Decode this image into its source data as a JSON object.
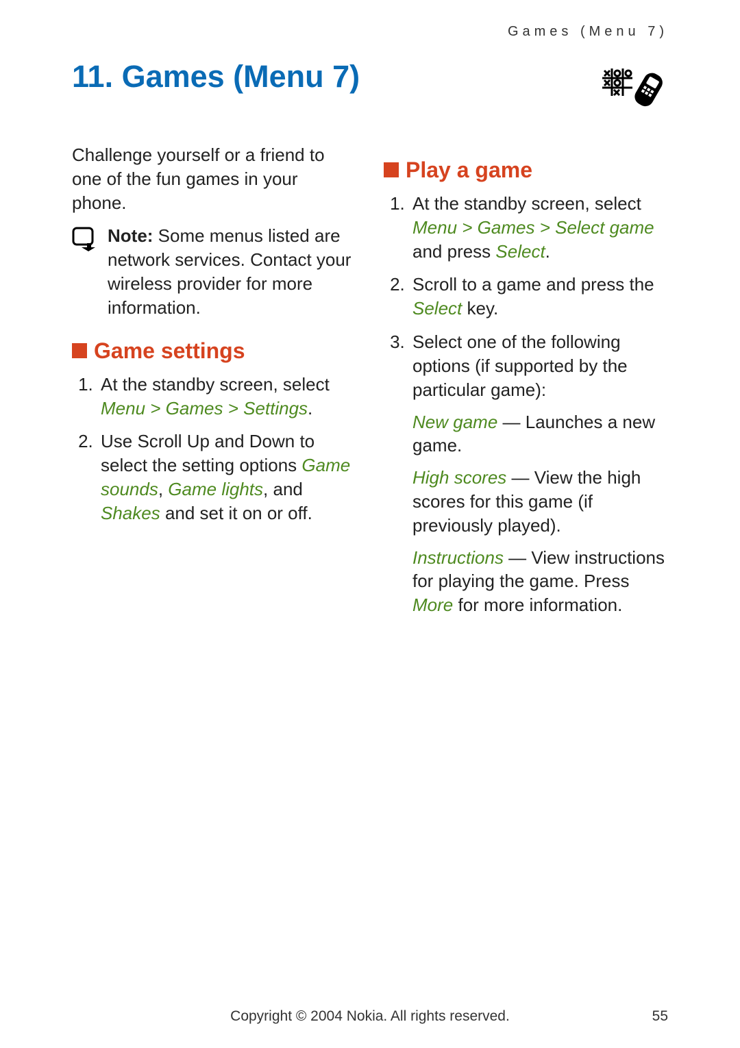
{
  "running_head": "Games (Menu 7)",
  "chapter_title": "11. Games (Menu 7)",
  "intro": "Challenge yourself or a friend to one of the fun games in your phone.",
  "note": {
    "label": "Note:",
    "body": " Some menus listed are network services. Contact your wireless provider for more information."
  },
  "section_settings": {
    "heading": "Game settings",
    "steps": {
      "s1_a": "At the standby screen, select ",
      "s1_b": "Menu > Games > Settings",
      "s1_c": ".",
      "s2_a": "Use Scroll Up and Down to select the setting options ",
      "s2_b": "Game sounds",
      "s2_c": ", ",
      "s2_d": "Game lights",
      "s2_e": ", and ",
      "s2_f": "Shakes",
      "s2_g": " and set it on or off."
    }
  },
  "section_play": {
    "heading": "Play a game",
    "steps": {
      "s1_a": "At the standby screen, select ",
      "s1_b": "Menu > Games > Select game",
      "s1_c": " and press ",
      "s1_d": "Select",
      "s1_e": ".",
      "s2_a": "Scroll to a game and press the ",
      "s2_b": "Select",
      "s2_c": " key.",
      "s3": "Select one of the following options (if supported by the particular game):"
    },
    "opts": {
      "o1_a": "New game",
      "o1_b": " — Launches a new game.",
      "o2_a": "High scores",
      "o2_b": " — View the high scores for this game (if previously played).",
      "o3_a": "Instructions",
      "o3_b": " — View instructions for playing the game. Press ",
      "o3_c": "More",
      "o3_d": " for more information."
    }
  },
  "footer": {
    "copyright": "Copyright © 2004 Nokia. All rights reserved.",
    "page": "55"
  }
}
